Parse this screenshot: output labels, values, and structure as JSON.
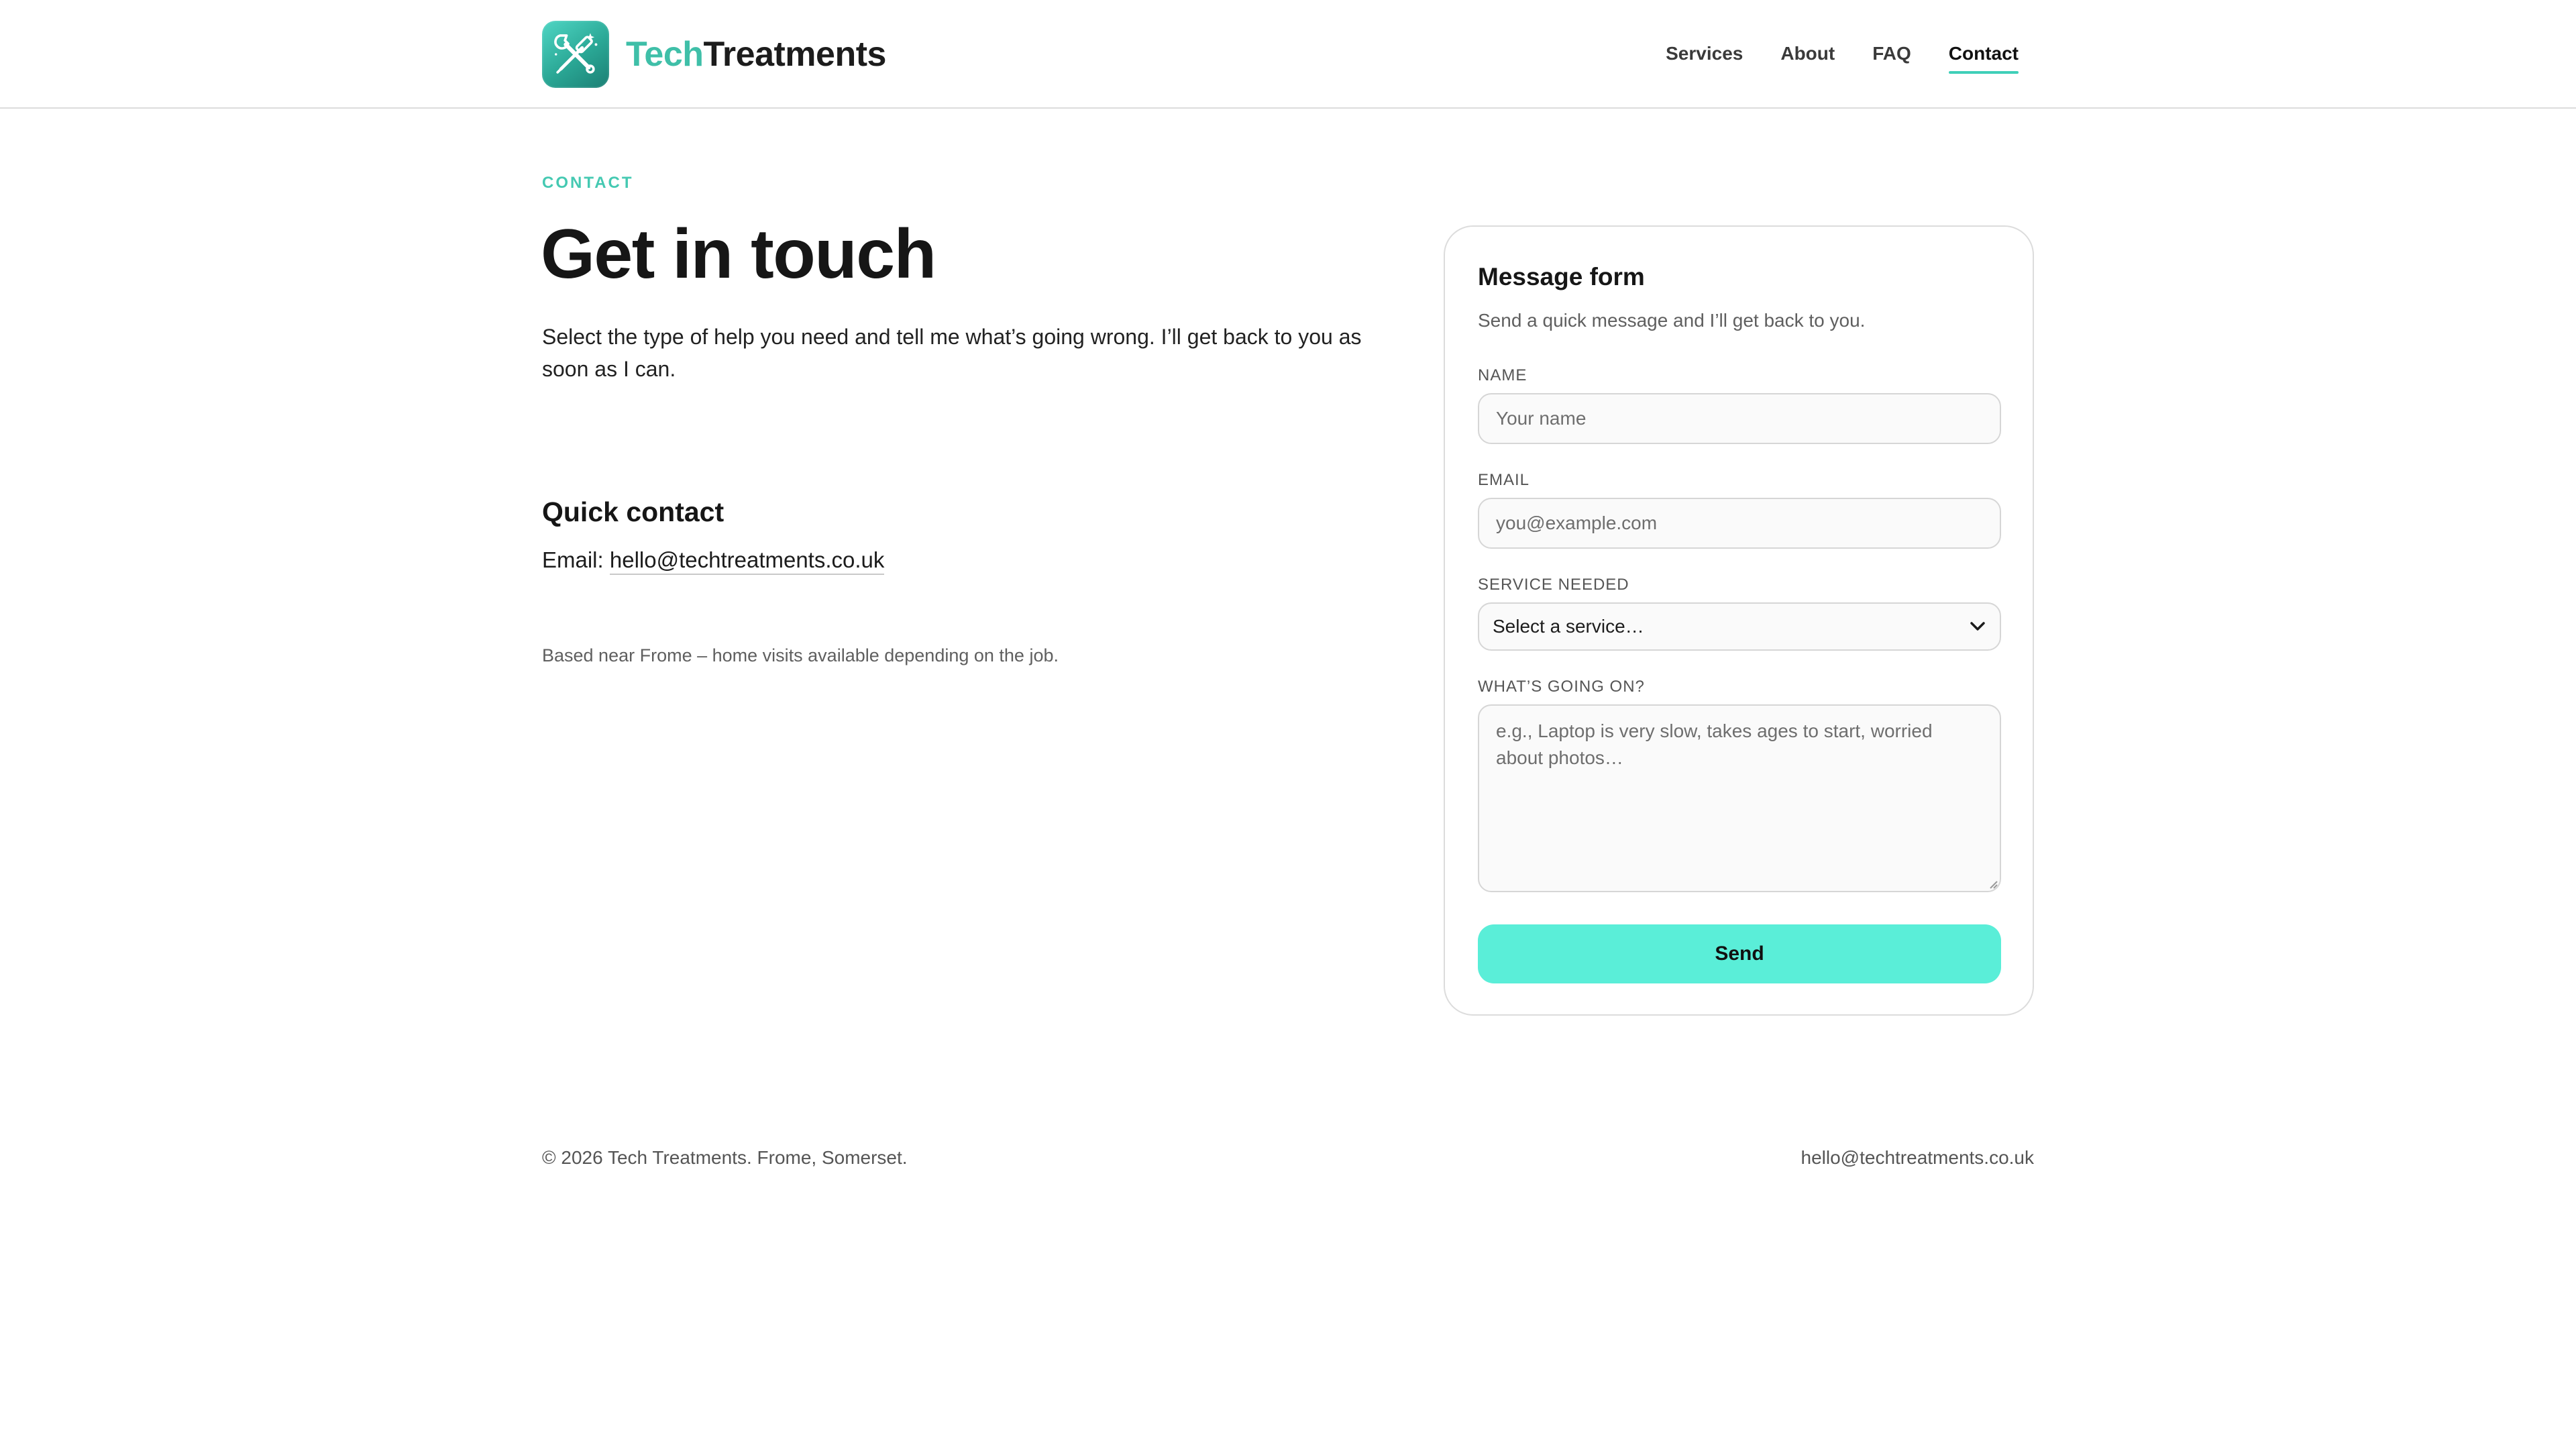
{
  "brand": {
    "name_part1": "Tech",
    "name_part2": "Treatments",
    "logo_icon": "wrench-screwdriver-icon",
    "accent_color": "#3fbfa8"
  },
  "nav": {
    "items": [
      {
        "label": "Services",
        "active": false
      },
      {
        "label": "About",
        "active": false
      },
      {
        "label": "FAQ",
        "active": false
      },
      {
        "label": "Contact",
        "active": true
      }
    ]
  },
  "hero": {
    "eyebrow": "CONTACT",
    "title": "Get in touch",
    "intro": "Select the type of help you need and tell me what’s going wrong. I’ll get back to you as soon as I can."
  },
  "quick_contact": {
    "heading": "Quick contact",
    "email_label": "Email:",
    "email": "hello@techtreatments.co.uk",
    "location_note": "Based near Frome – home visits available depending on the job."
  },
  "form": {
    "title": "Message form",
    "subtitle": "Send a quick message and I’ll get back to you.",
    "name_label": "NAME",
    "name_placeholder": "Your name",
    "name_value": "",
    "email_label": "EMAIL",
    "email_placeholder": "you@example.com",
    "email_value": "",
    "service_label": "SERVICE NEEDED",
    "service_selected": "Select a service…",
    "issue_label": "WHAT’S GOING ON?",
    "issue_placeholder": "e.g., Laptop is very slow, takes ages to start, worried about photos…",
    "issue_value": "",
    "send_label": "Send",
    "button_color": "#5aeed8"
  },
  "footer": {
    "copyright": "© 2026 Tech Treatments. Frome, Somerset.",
    "email": "hello@techtreatments.co.uk"
  }
}
